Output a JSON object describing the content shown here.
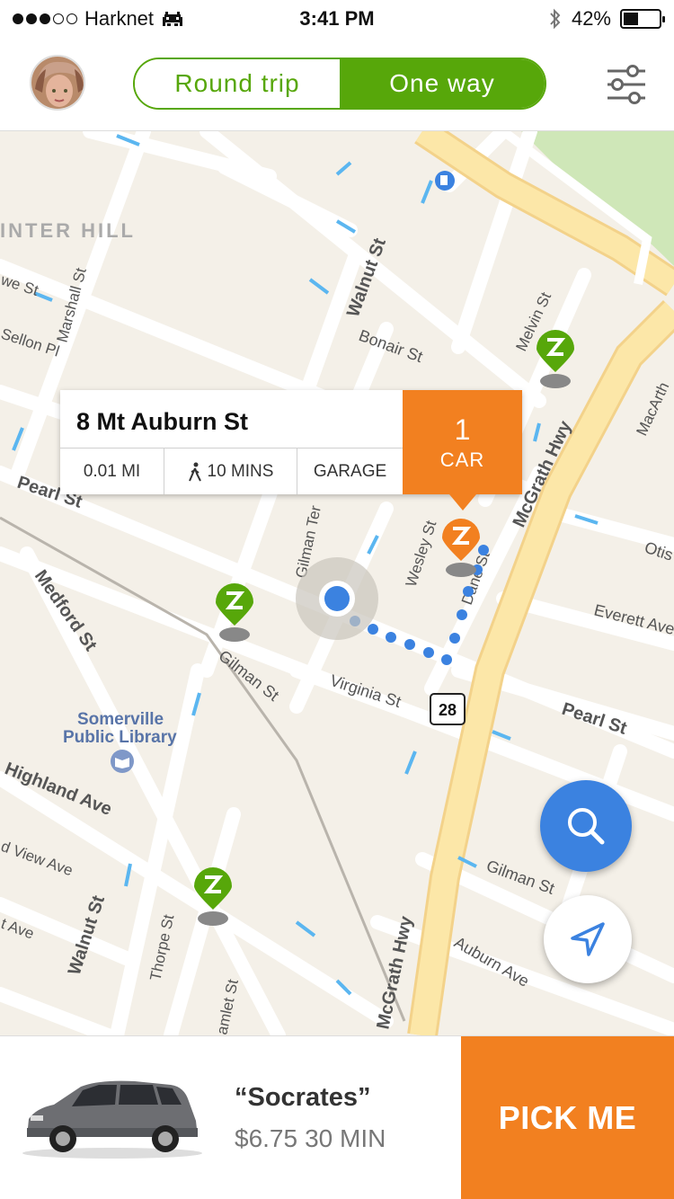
{
  "status_bar": {
    "carrier": "Harknet",
    "time": "3:41 PM",
    "battery": "42%",
    "battery_level": 0.42,
    "icons": [
      "signal-dots",
      "invader-icon",
      "bluetooth-icon",
      "battery-icon"
    ]
  },
  "header": {
    "toggle": {
      "round_trip": "Round trip",
      "one_way": "One way",
      "selected": "One way"
    },
    "avatar": "user-avatar",
    "filter_icon": "sliders-icon"
  },
  "colors": {
    "brand_green": "#57a70a",
    "accent_orange": "#f28020",
    "route_blue": "#3b82e0",
    "map_bg": "#f4f0e8",
    "road_major": "#fce7a8"
  },
  "map": {
    "labels": {
      "neighborhood": "INTER HILL",
      "walnut_st": "Walnut St",
      "marshall_st": "Marshall St",
      "bonair_st": "Bonair St",
      "melvin_st": "Melvin St",
      "mcgrath_hwy": "McGrath Hwy",
      "macarthur": "MacArth",
      "pearl_st": "Pearl St",
      "gilman_ter": "Gilman Ter",
      "wesley_st": "Wesley St",
      "dane_st": "Dane St",
      "otis": "Otis",
      "everett_ave": "Everett Ave",
      "medford_st": "Medford St",
      "gilman_st": "Gilman St",
      "virginia_st": "Virginia St",
      "library_line1": "Somerville",
      "library_line2": "Public Library",
      "highland_ave": "Highland Ave",
      "view_ave": "d View Ave",
      "t_ave": "t Ave",
      "thorpe_st": "Thorpe St",
      "hamlet_st": "amlet St",
      "auburn_ave": "Auburn Ave",
      "we_st": "we St",
      "sellon_pl": "Sellon Pl",
      "route_shield": "28"
    },
    "popup": {
      "address": "8 Mt Auburn St",
      "distance": "0.01 MI",
      "walk_time": "10 MINS",
      "location_type": "GARAGE",
      "car_count": "1",
      "car_label": "CAR"
    },
    "buttons": {
      "search": "magnifier-icon",
      "locate": "navigation-arrow-icon"
    }
  },
  "bottom": {
    "car_name": "“Socrates”",
    "price": "$6.75",
    "duration": "30 MIN",
    "pick_button": "PICK ME"
  }
}
